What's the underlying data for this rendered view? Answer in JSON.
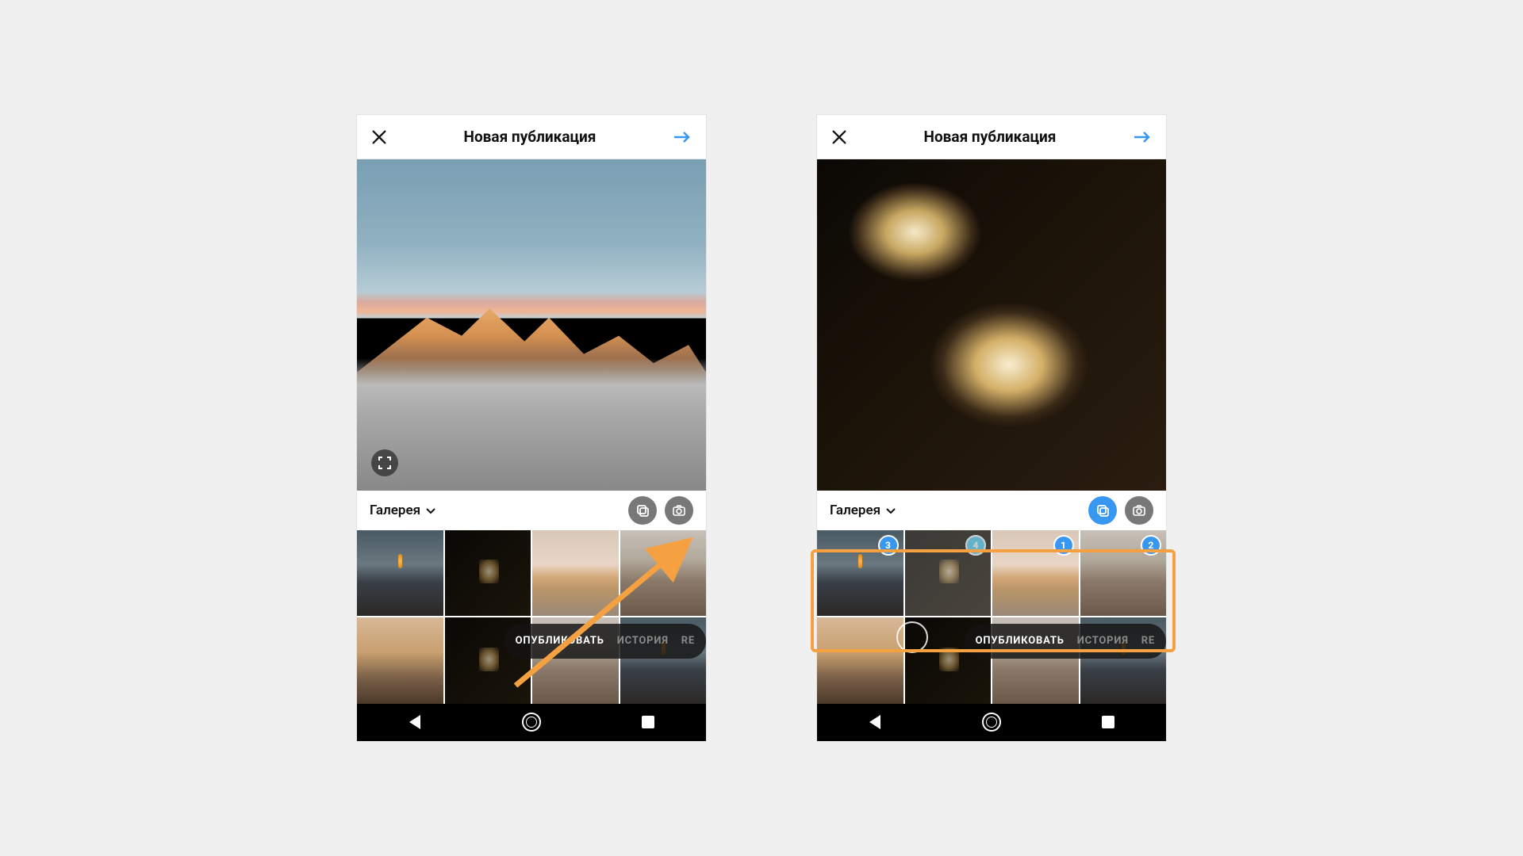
{
  "header": {
    "title": "Новая публикация"
  },
  "gallery": {
    "label": "Галерея"
  },
  "pill": {
    "publish": "ОПУБЛИКОВАТЬ",
    "story": "ИСТОРИЯ",
    "reels": "RE"
  },
  "right": {
    "badges": [
      "3",
      "4",
      "1",
      "2"
    ]
  },
  "colors": {
    "accent": "#3897f0",
    "highlight": "#f5a142"
  }
}
